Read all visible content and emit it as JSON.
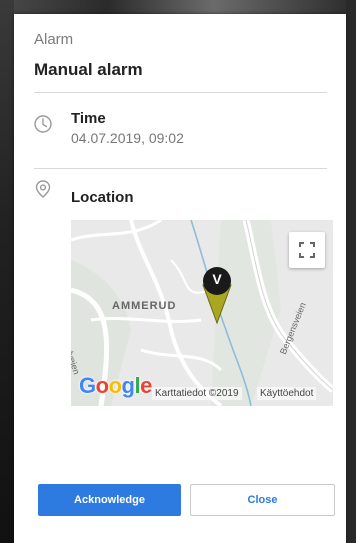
{
  "dialog": {
    "kicker": "Alarm",
    "title": "Manual alarm"
  },
  "time": {
    "icon": "clock-icon",
    "label": "Time",
    "value": "04.07.2019, 09:02"
  },
  "location": {
    "icon": "location-pin-icon",
    "label": "Location",
    "map": {
      "area_label": "AMMERUD",
      "road_left": "Ammerudveien",
      "road_right": "Bergensveien",
      "marker_letter": "V",
      "logo": "Google",
      "attribution": "Karttatiedot ©2019",
      "terms": "Käyttöehdot",
      "fullscreen_icon": "fullscreen-icon"
    }
  },
  "actions": {
    "acknowledge": "Acknowledge",
    "close": "Close"
  },
  "colors": {
    "primary": "#2d7be0",
    "marker_fill": "#a0a020",
    "marker_badge": "#1a1a1a"
  }
}
